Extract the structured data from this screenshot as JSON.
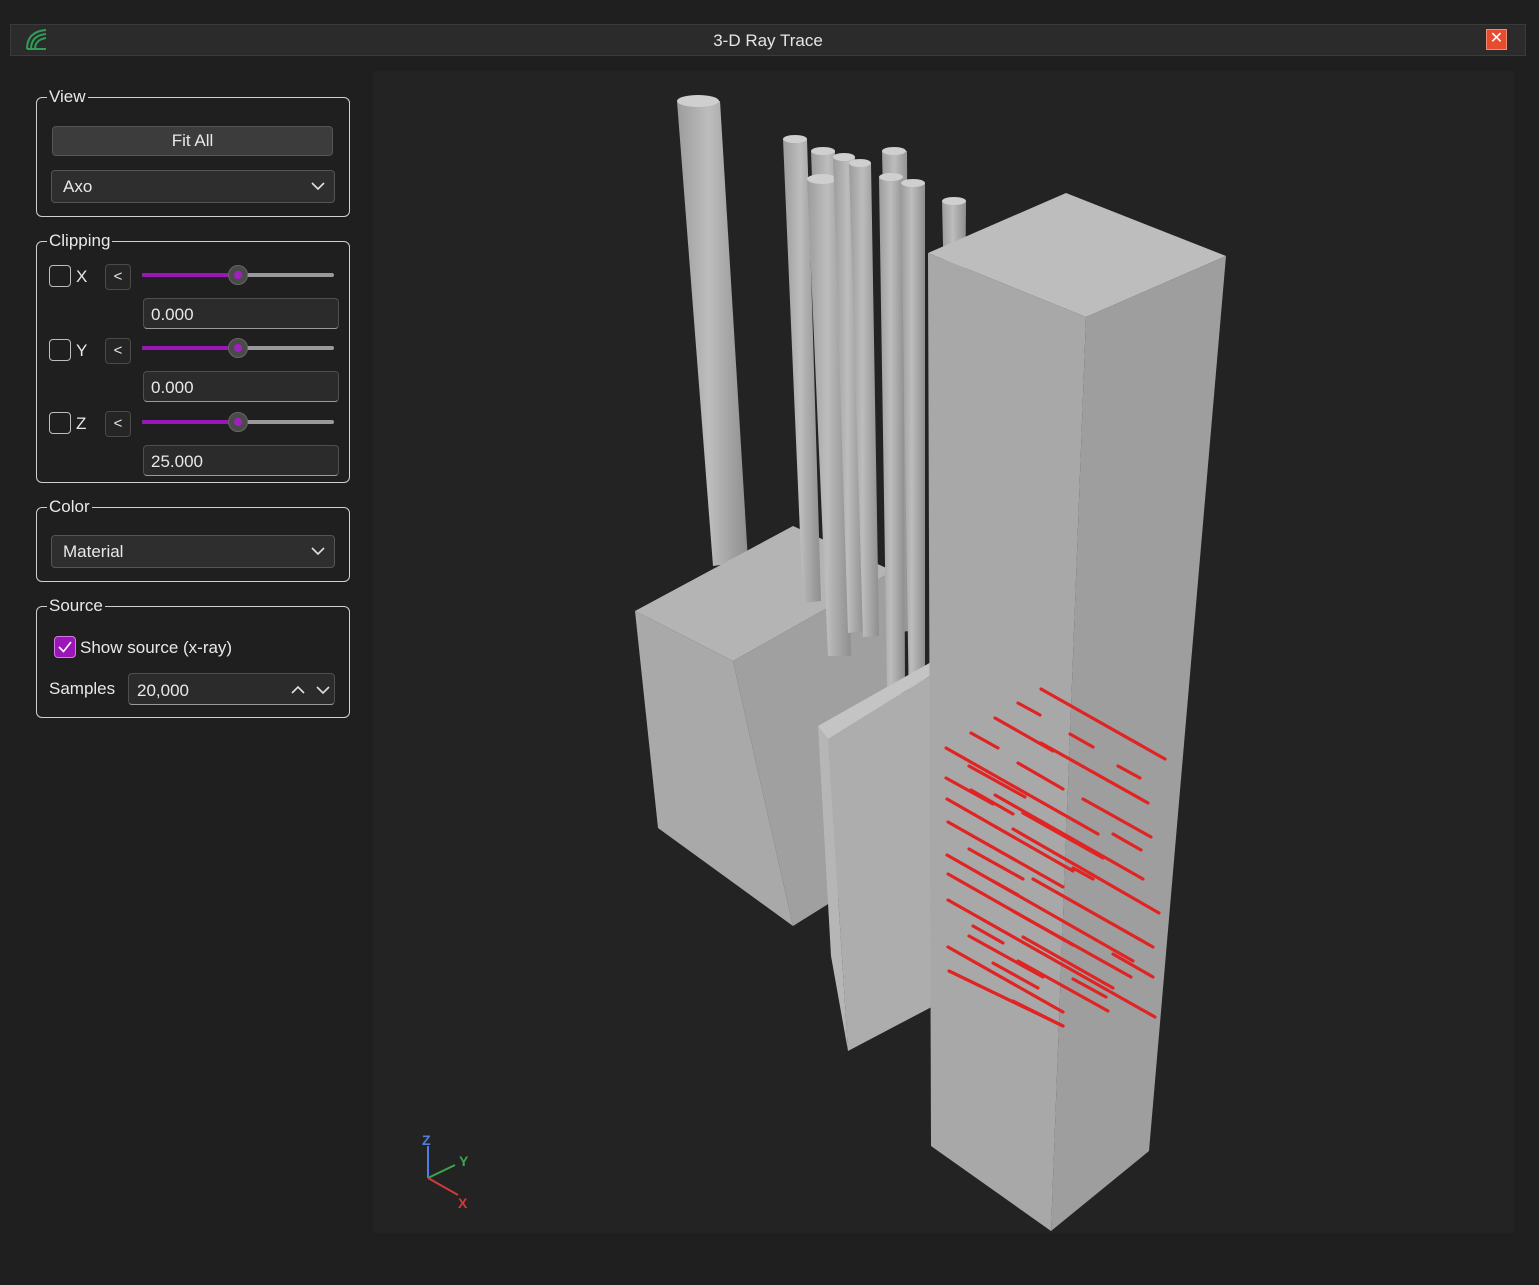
{
  "window": {
    "title": "3-D Ray Trace",
    "close_label": "✕"
  },
  "view": {
    "legend": "View",
    "fit_all_label": "Fit All",
    "view_mode": "Axo"
  },
  "clipping": {
    "legend": "Clipping",
    "direction_label": "<",
    "axes": [
      {
        "axis": "X",
        "enabled": false,
        "slider_fraction": 0.5,
        "value": "0.000"
      },
      {
        "axis": "Y",
        "enabled": false,
        "slider_fraction": 0.5,
        "value": "0.000"
      },
      {
        "axis": "Z",
        "enabled": false,
        "slider_fraction": 0.5,
        "value": "25.000"
      }
    ]
  },
  "color": {
    "legend": "Color",
    "mode": "Material"
  },
  "source": {
    "legend": "Source",
    "show_source_label": "Show source (x-ray)",
    "show_source_checked": true,
    "samples_label": "Samples",
    "samples_value": "20,000"
  },
  "viewport": {
    "triad": {
      "z_label": "Z",
      "y_label": "Y",
      "x_label": "X"
    }
  },
  "colors": {
    "accent": "#9b16b8",
    "ray": "#e03030",
    "geometry": "#a8a8a8",
    "background": "#1f1f1f",
    "close": "#e74c2f"
  }
}
